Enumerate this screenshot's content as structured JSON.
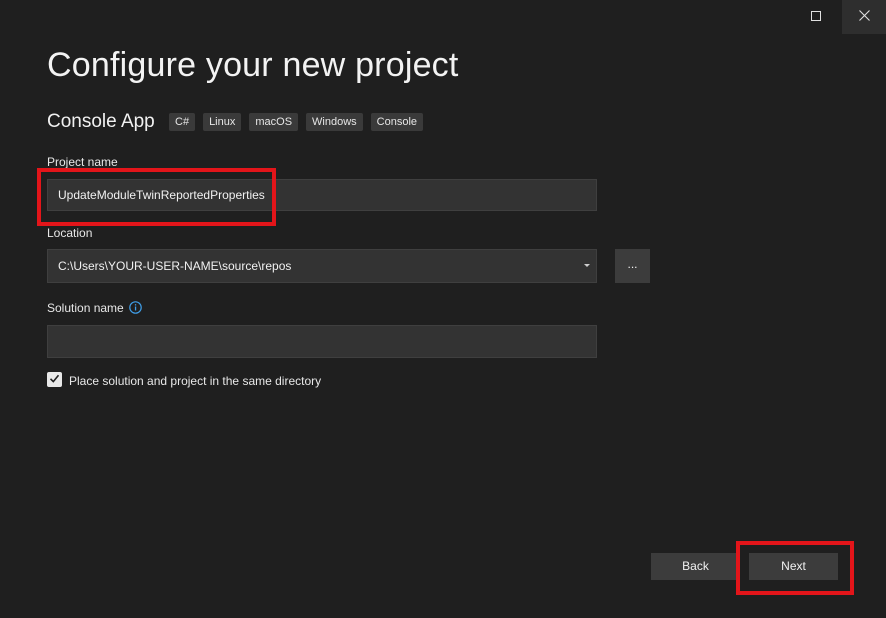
{
  "window": {
    "maximize_icon": "maximize-icon",
    "close_icon": "close-icon"
  },
  "header": {
    "title": "Configure your new project",
    "template_name": "Console App",
    "tags": [
      "C#",
      "Linux",
      "macOS",
      "Windows",
      "Console"
    ]
  },
  "form": {
    "project_name_label": "Project name",
    "project_name_value": "UpdateModuleTwinReportedProperties",
    "location_label": "Location",
    "location_value": "C:\\Users\\YOUR-USER-NAME\\source\\repos",
    "browse_label": "...",
    "solution_name_label": "Solution name",
    "solution_name_value": "",
    "same_directory_label": "Place solution and project in the same directory",
    "same_directory_checked": true
  },
  "footer": {
    "back_label": "Back",
    "next_label": "Next"
  },
  "colors": {
    "background": "#1f1f1f",
    "input_bg": "#333333",
    "button_bg": "#3c3c3c",
    "highlight": "#e3151a",
    "info_blue": "#3f9ee8"
  }
}
